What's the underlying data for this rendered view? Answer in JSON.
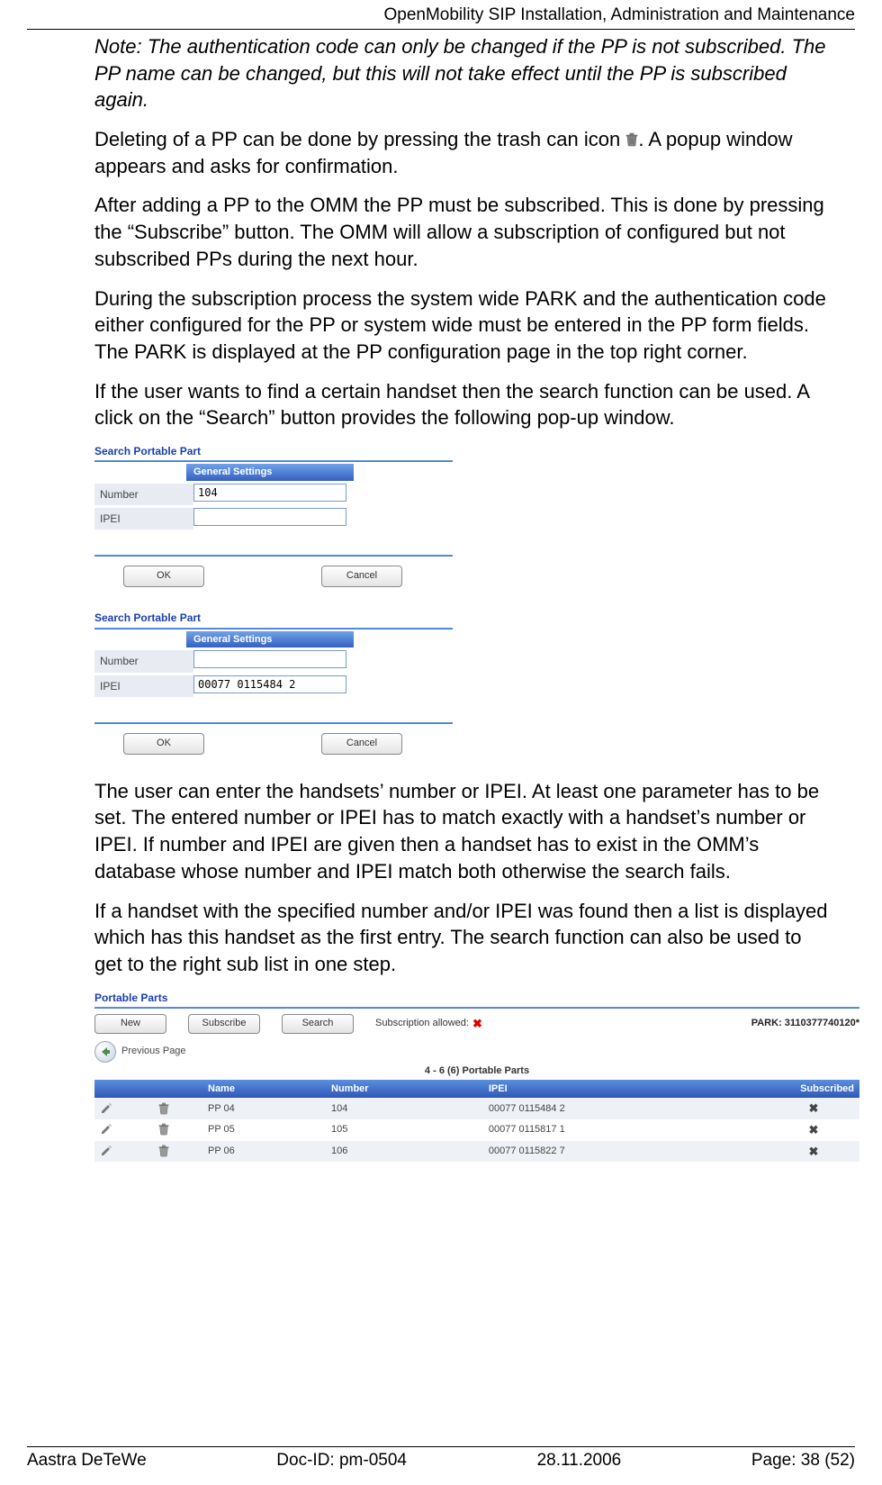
{
  "header": {
    "title": "OpenMobility SIP Installation, Administration and Maintenance"
  },
  "body": {
    "note": "Note: The authentication code can only be changed if the PP is not subscribed. The PP name can be changed, but this will not take effect until the PP is subscribed again.",
    "p_delete_a": "Deleting of a PP can be done by pressing the trash can icon ",
    "p_delete_b": ". A popup window appears and asks for confirmation.",
    "p_subscribe": "After adding a PP to the OMM the PP must be subscribed. This is done by pressing the “Subscribe” button. The OMM will allow a subscription of configured but not subscribed PPs during the next hour.",
    "p_park": "During the subscription process the system wide PARK and the authentication code either configured for the PP or system wide must be entered in the PP form fields. The PARK is displayed at the PP configuration page in the top right corner.",
    "p_search": "If the user wants to find a certain handset then the search function can be used. A click on the “Search” button provides the following pop-up window.",
    "p_enter": "The user can enter the handsets’ number or IPEI. At least one parameter has to be set. The entered number or IPEI has to match exactly with a handset’s number or IPEI. If number and IPEI are given then a handset has to exist in the OMM’s database whose number and IPEI match both otherwise the search fails.",
    "p_found": "If a handset with the specified number and/or IPEI was found then a list is displayed which has this handset as the first entry. The search function can also be used to get to the right sub list in one step."
  },
  "popup": {
    "title": "Search Portable Part",
    "section": "General Settings",
    "number_label": "Number",
    "ipei_label": "IPEI",
    "ok": "OK",
    "cancel": "Cancel",
    "first": {
      "number": "104",
      "ipei": ""
    },
    "second": {
      "number": "",
      "ipei": "00077 0115484 2"
    }
  },
  "pp": {
    "title": "Portable Parts",
    "new": "New",
    "subscribe": "Subscribe",
    "search": "Search",
    "sub_allowed": "Subscription allowed:",
    "park": "PARK: 3110377740120*",
    "prev": "Previous Page",
    "count": "4 - 6 (6) Portable Parts",
    "cols": {
      "name": "Name",
      "number": "Number",
      "ipei": "IPEI",
      "subscribed": "Subscribed"
    },
    "rows": [
      {
        "name": "PP 04",
        "number": "104",
        "ipei": "00077 0115484 2"
      },
      {
        "name": "PP 05",
        "number": "105",
        "ipei": "00077 0115817 1"
      },
      {
        "name": "PP 06",
        "number": "106",
        "ipei": "00077 0115822 7"
      }
    ]
  },
  "footer": {
    "company": "Aastra DeTeWe",
    "docid": "Doc-ID: pm-0504",
    "date": "28.11.2006",
    "page": "Page: 38 (52)"
  }
}
